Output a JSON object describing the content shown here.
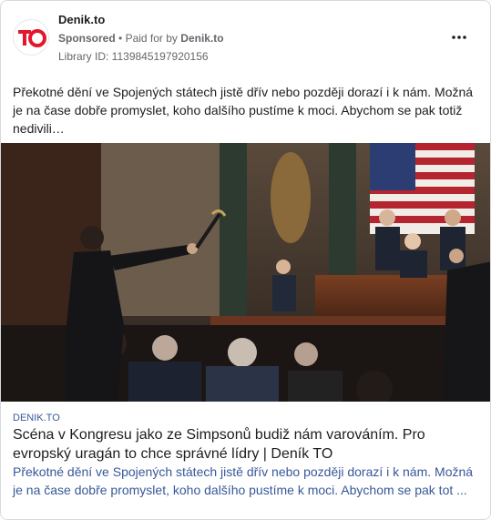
{
  "ad": {
    "page_name": "Denik.to",
    "sponsored_label": "Sponsored",
    "separator": "•",
    "paid_for_prefix": "Paid for by",
    "paid_for_by": "Denik.to",
    "library_id": "Library ID: 1139845197920156",
    "menu_icon": "more-dots-icon",
    "body_text": "Překotné dění ve Spojených státech jistě dřív nebo později dorazí i k nám. Možná je na čase dobře promyslet, koho dalšího pustíme k moci. Abychom se pak totiž nedivili…",
    "logo": {
      "letters": "TO",
      "color": "#e3172b"
    }
  },
  "link_preview": {
    "domain": "DENIK.TO",
    "title": "Scéna v Kongresu jako ze Simpsonů budiž nám varováním. Pro evropský uragán to chce správné lídry | Deník TO",
    "description": "Překotné dění ve Spojených státech jistě dřív nebo později dorazí i k nám. Možná\nje na čase dobře promyslet, koho dalšího pustíme k moci. Abychom se pak tot ..."
  },
  "colors": {
    "link_blue": "#385898",
    "meta_grey": "#65676b",
    "brand_red": "#e3172b"
  }
}
